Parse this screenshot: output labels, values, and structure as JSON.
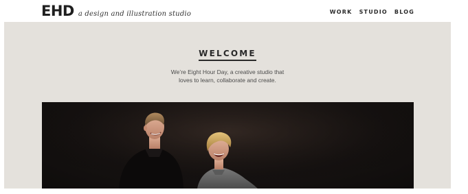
{
  "brand": {
    "logo": "EHD",
    "tagline": "a design and illustration studio"
  },
  "nav": {
    "items": [
      "WORK",
      "STUDIO",
      "BLOG"
    ]
  },
  "hero": {
    "heading": "WELCOME",
    "intro_line1": "We’re Eight Hour Day, a creative studio that",
    "intro_line2": "loves to learn, collaborate and create."
  },
  "photo": {
    "subject": "studio-founders-photo"
  },
  "colors": {
    "panel_bg": "#e4e1dc",
    "photo_bg": "#161211",
    "text_dark": "#2a2a2a"
  }
}
